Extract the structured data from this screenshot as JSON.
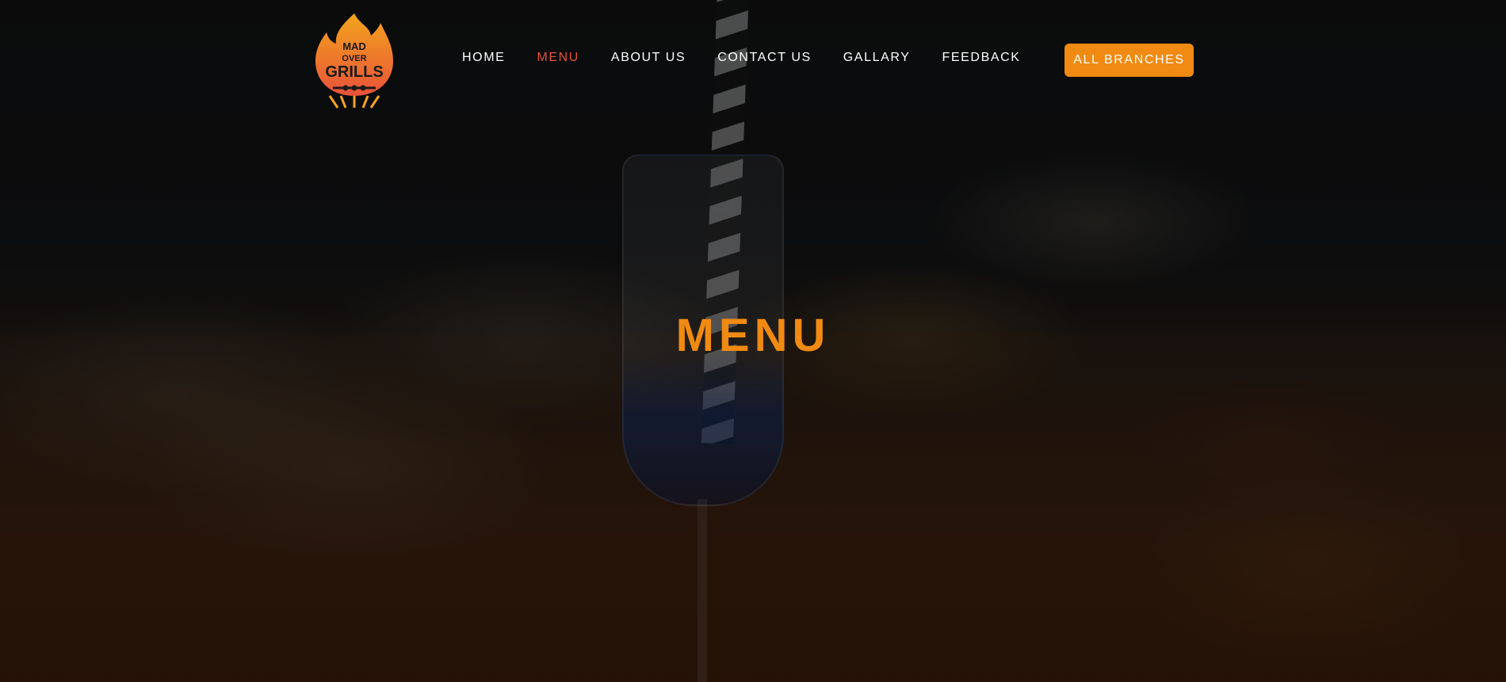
{
  "brand": {
    "logo_text_line1": "MAD",
    "logo_text_line2": "OVER",
    "logo_text_line3": "GRILLS",
    "logo_colors": [
      "#f4a51c",
      "#e8523a",
      "#1a1a1a"
    ]
  },
  "nav": {
    "items": [
      {
        "label": "HOME",
        "active": false
      },
      {
        "label": "MENU",
        "active": true
      },
      {
        "label": "ABOUT US",
        "active": false
      },
      {
        "label": "CONTACT US",
        "active": false
      },
      {
        "label": "GALLARY",
        "active": false
      },
      {
        "label": "FEEDBACK",
        "active": false
      }
    ],
    "cta_label": "ALL BRANCHES"
  },
  "hero": {
    "title": "MENU"
  },
  "colors": {
    "accent": "#f08a12",
    "active_link": "#e8523a",
    "text": "#ffffff"
  }
}
